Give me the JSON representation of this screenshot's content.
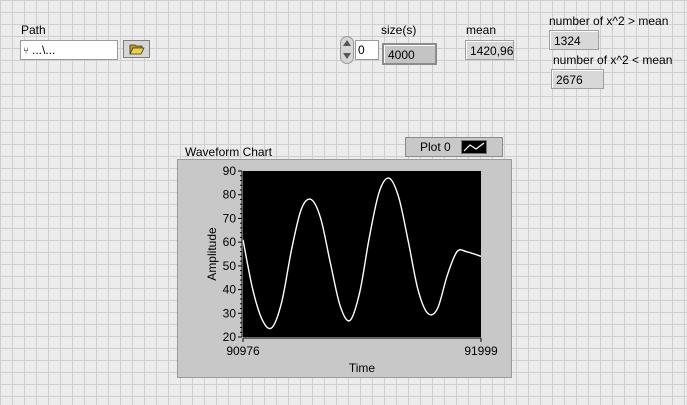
{
  "path": {
    "label": "Path",
    "value": "...\\..."
  },
  "size": {
    "label": "size(s)",
    "numeric_value": "0",
    "value": "4000"
  },
  "mean": {
    "label": "mean",
    "value": "1420,96"
  },
  "greater": {
    "label": "number of x^2 > mean",
    "value": "1324"
  },
  "less": {
    "label": "number of x^2 < mean",
    "value": "2676"
  },
  "chart": {
    "title": "Waveform Chart",
    "legend_label": "Plot 0"
  },
  "chart_data": {
    "type": "line",
    "title": "Waveform Chart",
    "xlabel": "Time",
    "ylabel": "Amplitude",
    "xlim": [
      90976,
      91999
    ],
    "ylim": [
      20,
      90
    ],
    "x_ticks": [
      "90976",
      "91999"
    ],
    "y_ticks": [
      "20",
      "30",
      "40",
      "50",
      "60",
      "70",
      "80",
      "90"
    ],
    "series": [
      {
        "name": "Plot 0",
        "color": "#ffffff",
        "x": [
          90976,
          91018,
          91060,
          91101,
          91143,
          91185,
          91227,
          91269,
          91310,
          91352,
          91394,
          91436,
          91478,
          91519,
          91561,
          91603,
          91645,
          91687,
          91728,
          91770,
          91812,
          91854,
          91896,
          91937,
          91999
        ],
        "y": [
          61,
          40,
          27,
          24,
          35,
          57,
          74,
          78,
          70,
          51,
          33,
          27,
          39,
          62,
          81,
          87,
          79,
          60,
          40,
          30,
          32,
          46,
          56,
          56,
          54
        ]
      }
    ]
  }
}
